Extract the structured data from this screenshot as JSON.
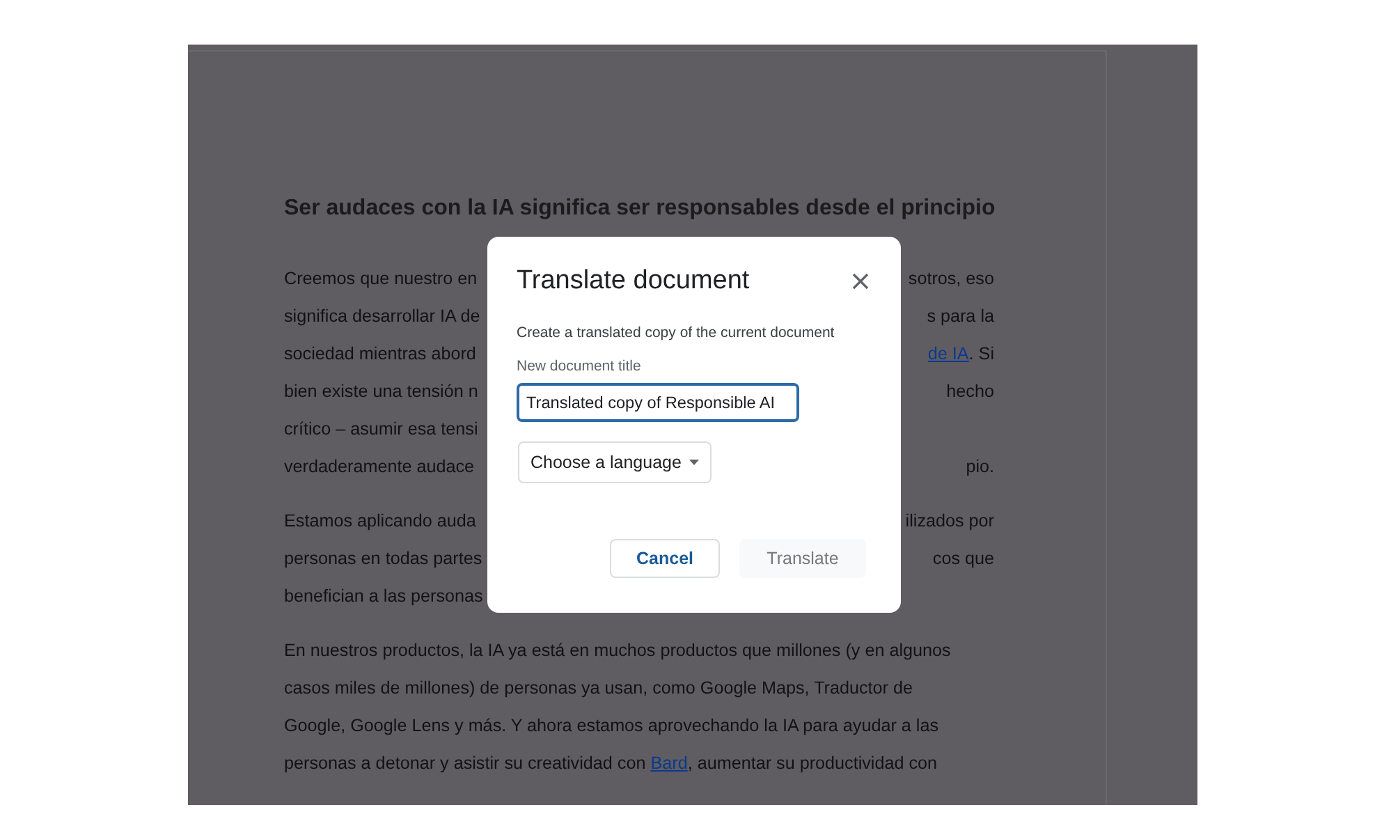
{
  "document": {
    "heading": "Ser audaces con la IA significa ser responsables desde el principio",
    "paragraphs": [
      {
        "lines": [
          {
            "left": [
              {
                "text": "Creemos que nuestro en",
                "link": false
              }
            ],
            "right": [
              {
                "text": "sotros, eso",
                "link": false
              }
            ]
          },
          {
            "left": [
              {
                "text": "significa desarrollar IA de",
                "link": false
              }
            ],
            "right": [
              {
                "text": "s para la",
                "link": false
              }
            ]
          },
          {
            "left": [
              {
                "text": "sociedad mientras abord",
                "link": false
              }
            ],
            "right": [
              {
                "text": "de IA",
                "link": true
              },
              {
                "text": ". Si",
                "link": false
              }
            ]
          },
          {
            "left": [
              {
                "text": "bien existe una tensión n",
                "link": false
              }
            ],
            "right": [
              {
                "text": "hecho",
                "link": false
              }
            ]
          },
          {
            "left": [
              {
                "text": "crítico – asumir esa tensi",
                "link": false
              }
            ]
          },
          {
            "left": [
              {
                "text": "verdaderamente audace",
                "link": false
              }
            ],
            "right": [
              {
                "text": "pio.",
                "link": false
              }
            ]
          }
        ]
      },
      {
        "lines": [
          {
            "left": [
              {
                "text": "Estamos aplicando auda",
                "link": false
              }
            ],
            "right": [
              {
                "text": "ilizados por",
                "link": false
              }
            ]
          },
          {
            "left": [
              {
                "text": "personas en todas partes",
                "link": false
              }
            ],
            "right": [
              {
                "text": "cos que",
                "link": false
              }
            ]
          },
          {
            "left": [
              {
                "text": "benefician a las personas",
                "link": false
              }
            ]
          }
        ]
      },
      {
        "lines": [
          {
            "left": [
              {
                "text": "En nuestros productos, la IA ya está en muchos productos que millones (y en algunos",
                "link": false
              }
            ]
          },
          {
            "left": [
              {
                "text": "casos miles de millones) de personas ya usan, como Google Maps, Traductor de",
                "link": false
              }
            ]
          },
          {
            "left": [
              {
                "text": "Google, Google Lens y más. Y ahora estamos aprovechando la IA para ayudar a las",
                "link": false
              }
            ]
          },
          {
            "left": [
              {
                "text": "personas a detonar y asistir su creatividad con ",
                "link": false
              },
              {
                "text": "Bard",
                "link": true
              },
              {
                "text": ", aumentar su productividad con",
                "link": false
              }
            ]
          }
        ]
      }
    ]
  },
  "dialog": {
    "title": "Translate document",
    "description": "Create a translated copy of the current document",
    "field_label": "New document title",
    "field_value": "Translated copy of Responsible AI",
    "language_dropdown": "Choose a language",
    "buttons": [
      {
        "label": "Cancel",
        "kind": "secondary",
        "disabled": false
      },
      {
        "label": "Translate",
        "kind": "primary",
        "disabled": true
      }
    ]
  }
}
